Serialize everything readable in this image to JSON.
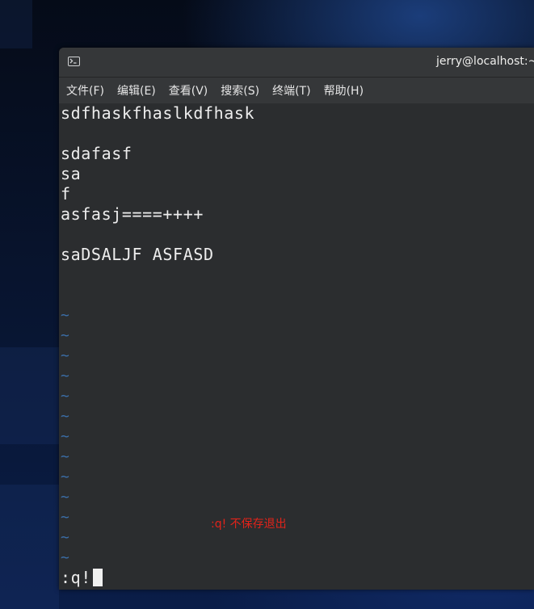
{
  "window": {
    "title": "jerry@localhost:~"
  },
  "menubar": {
    "items": [
      {
        "label": "文件(F)"
      },
      {
        "label": "编辑(E)"
      },
      {
        "label": "查看(V)"
      },
      {
        "label": "搜索(S)"
      },
      {
        "label": "终端(T)"
      },
      {
        "label": "帮助(H)"
      }
    ]
  },
  "terminal": {
    "lines": [
      "sdfhaskfhaslkdfhask",
      "",
      "sdafasf",
      "sa",
      "f",
      "asfasj====++++",
      "",
      "saDSALJF ASFASD"
    ],
    "empty_line_marker": "~",
    "empty_line_count": 13,
    "command": ":q!"
  },
  "annotation": {
    "text": ":q! 不保存退出",
    "color": "#e2231a"
  },
  "colors": {
    "terminal_bg": "#2b2d2f",
    "titlebar_bg": "#353739",
    "tilde": "#3b6ea8",
    "text": "#ededed"
  }
}
